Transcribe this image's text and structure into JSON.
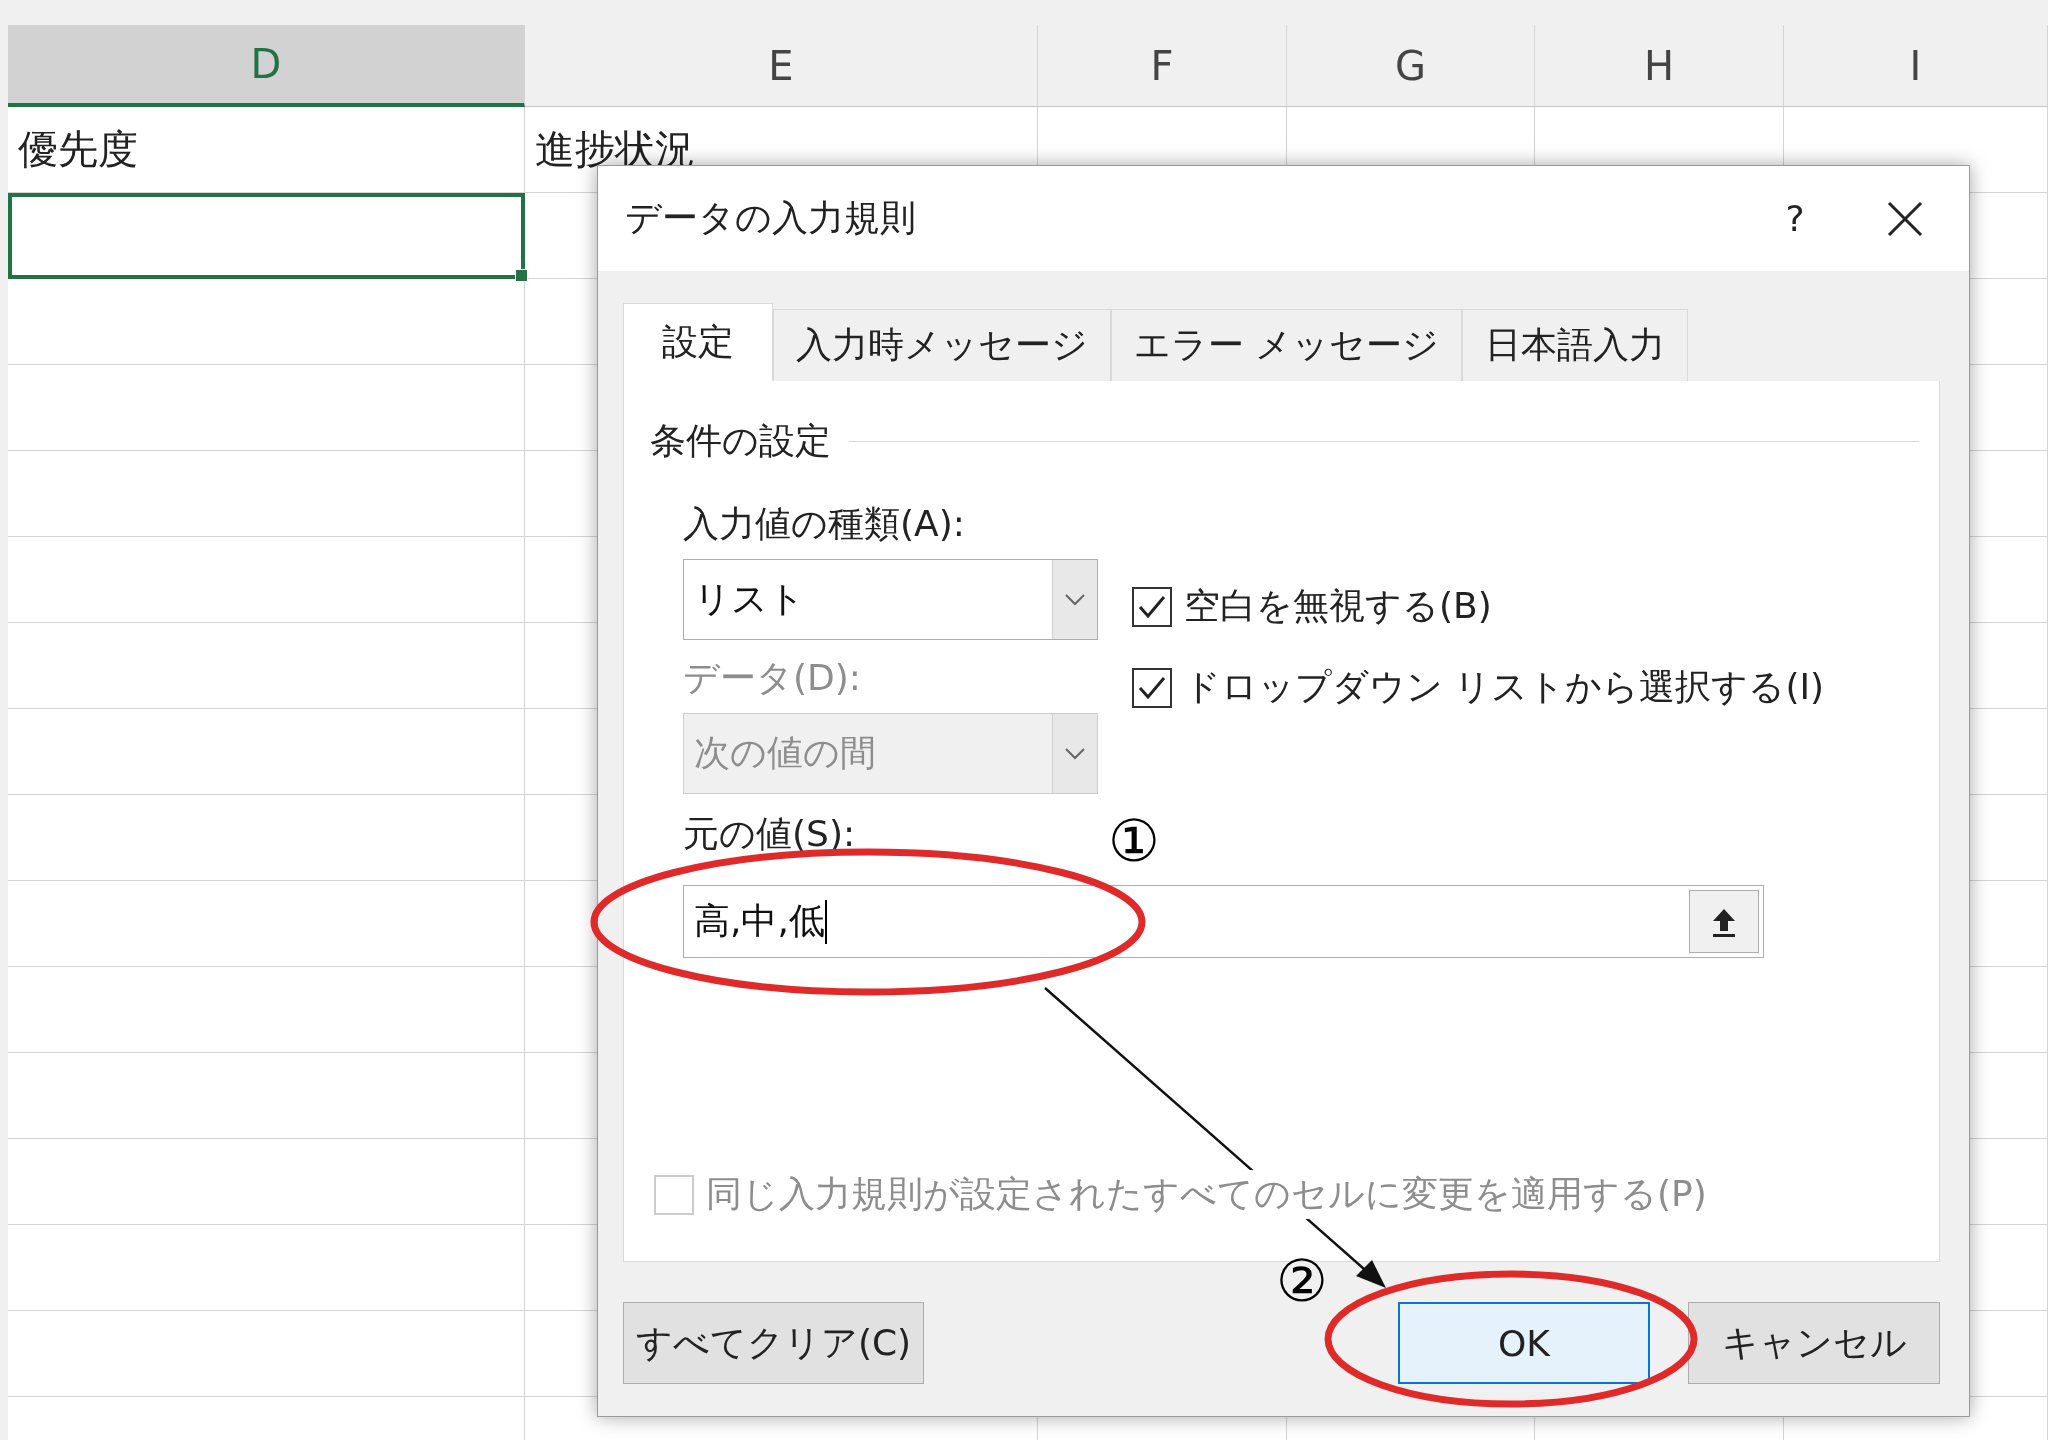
{
  "sheet": {
    "columns": [
      {
        "label": "D",
        "selected": true
      },
      {
        "label": "E",
        "selected": false
      },
      {
        "label": "F",
        "selected": false
      },
      {
        "label": "G",
        "selected": false
      },
      {
        "label": "H",
        "selected": false
      },
      {
        "label": "I",
        "selected": false
      }
    ],
    "rows": [
      {
        "cells": [
          {
            "text": "優先度",
            "selected": false
          },
          {
            "text": "進捗状況",
            "selected": false
          }
        ]
      },
      {
        "cells": [
          {
            "selected": true
          },
          {
            "selected": false
          }
        ]
      }
    ]
  },
  "dialog": {
    "title": "データの入力規則",
    "help": "?",
    "tabs": [
      {
        "label": "設定",
        "selected": true
      },
      {
        "label": "入力時メッセージ",
        "selected": false
      },
      {
        "label": "エラー メッセージ",
        "selected": false
      },
      {
        "label": "日本語入力",
        "selected": false
      }
    ],
    "section_title": "条件の設定",
    "allow": {
      "label": "入力値の種類(A):",
      "value": "リスト",
      "disabled": false
    },
    "data": {
      "label": "データ(D):",
      "value": "次の値の間",
      "disabled": true
    },
    "checkboxes": [
      {
        "label": "空白を無視する(B)",
        "checked": true
      },
      {
        "label": "ドロップダウン リストから選択する(I)",
        "checked": true
      }
    ],
    "source": {
      "label": "元の値(S):",
      "value": "高,中,低"
    },
    "apply_all": {
      "label": "同じ入力規則が設定されたすべてのセルに変更を適用する(P)",
      "checked": false,
      "disabled": true
    },
    "buttons": [
      {
        "label": "すべてクリア(C)",
        "kind": "default"
      },
      {
        "label": "OK",
        "kind": "primary"
      },
      {
        "label": "キャンセル",
        "kind": "default"
      }
    ]
  },
  "annotations": [
    {
      "number": "①"
    },
    {
      "number": "②"
    }
  ]
}
